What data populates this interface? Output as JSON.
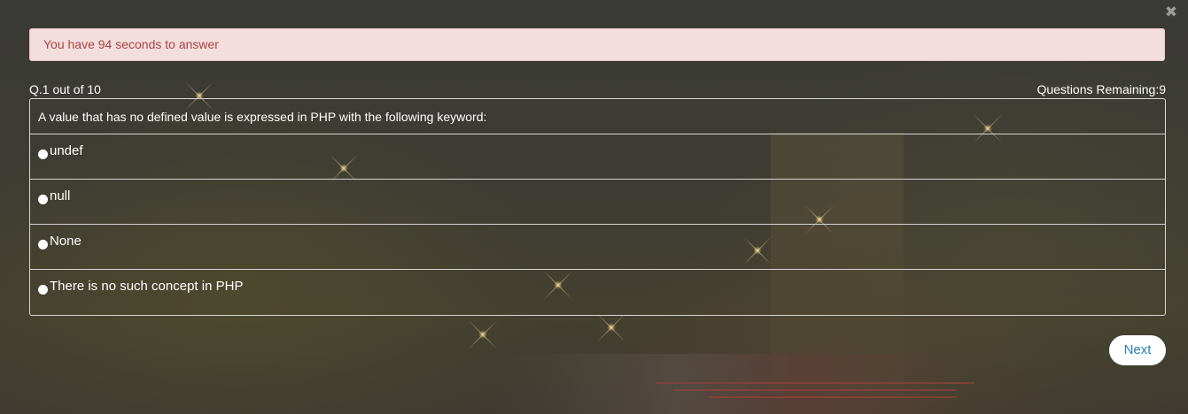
{
  "timer": {
    "message": "You have 94 seconds to answer"
  },
  "quiz": {
    "counter": "Q.1 out of 10",
    "remaining": "Questions Remaining:9",
    "question": "A value that has no defined value is expressed in PHP with the following keyword:",
    "options": [
      {
        "label": "undef"
      },
      {
        "label": "null"
      },
      {
        "label": "None"
      },
      {
        "label": "There is no such concept in PHP"
      }
    ],
    "next_label": "Next"
  },
  "icons": {
    "close": "close-icon",
    "radio": "radio-circle-icon"
  },
  "colors": {
    "alert_bg": "#f3dedd",
    "alert_text": "#a94442",
    "next_text": "#2e7fb6",
    "text": "#ffffff"
  }
}
